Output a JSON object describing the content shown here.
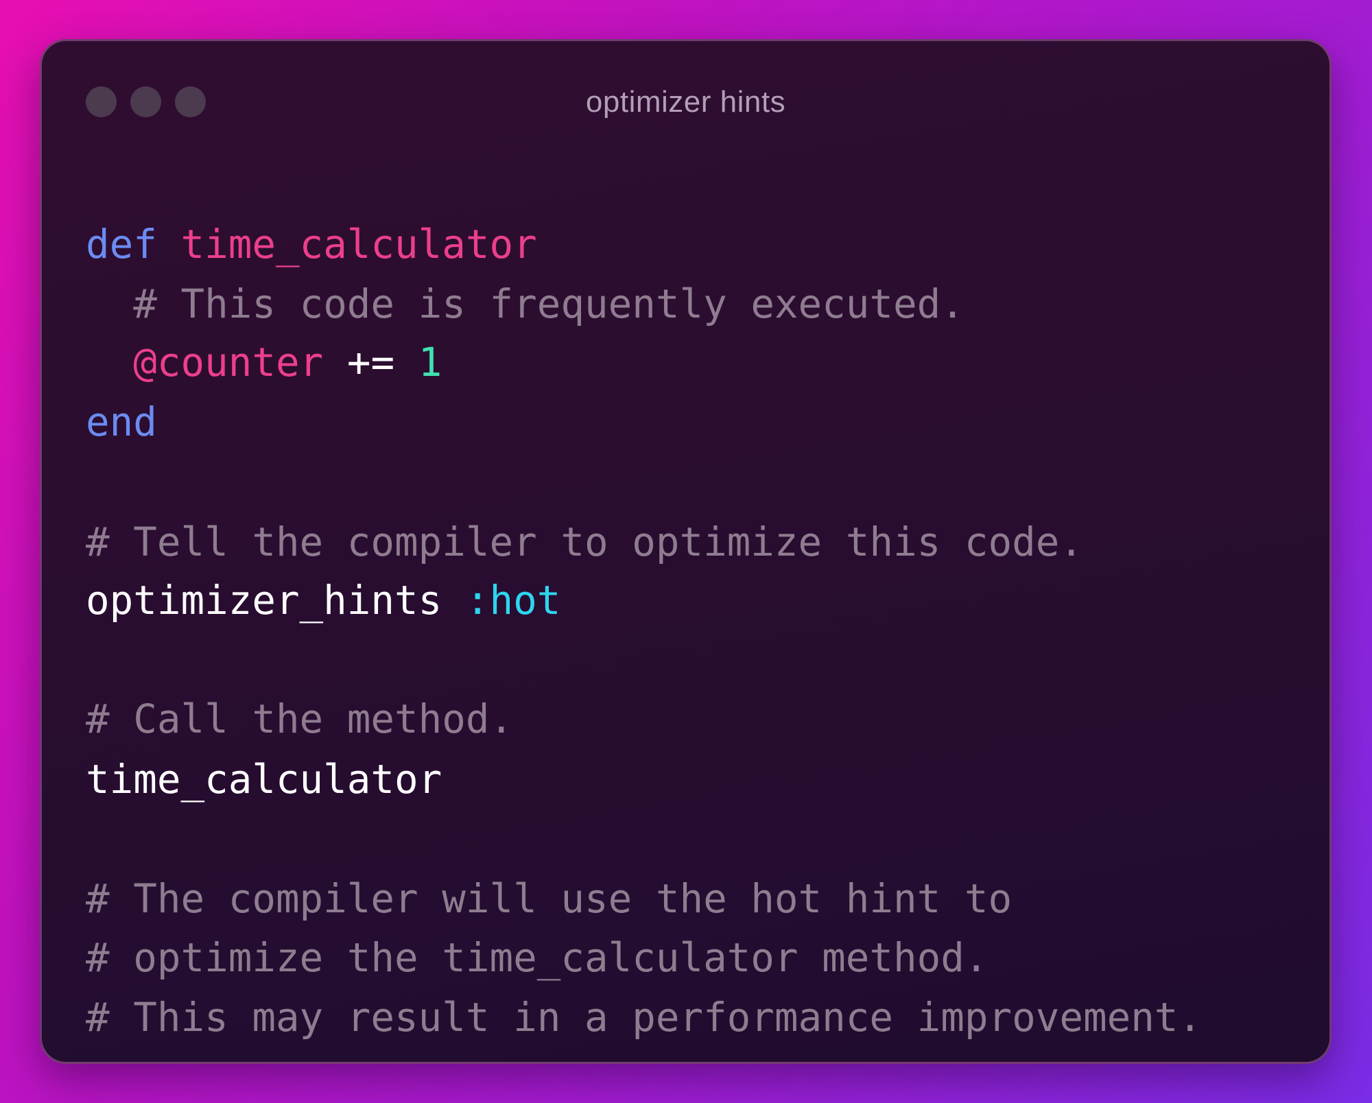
{
  "window": {
    "title": "optimizer hints"
  },
  "code": {
    "line1": {
      "keyword": "def",
      "space": " ",
      "function_name": "time_calculator"
    },
    "line2": {
      "indent": "  ",
      "comment": "# This code is frequently executed."
    },
    "line3": {
      "indent": "  ",
      "ivar": "@counter",
      "operator": " += ",
      "number": "1"
    },
    "line4": {
      "keyword": "end"
    },
    "line6": {
      "comment": "# Tell the compiler to optimize this code."
    },
    "line7": {
      "method": "optimizer_hints ",
      "symbol": ":hot"
    },
    "line9": {
      "comment": "# Call the method."
    },
    "line10": {
      "call": "time_calculator"
    },
    "line12": {
      "comment": "# The compiler will use the hot hint to"
    },
    "line13": {
      "comment": "# optimize the time_calculator method."
    },
    "line14": {
      "comment": "# This may result in a performance improvement."
    }
  },
  "colors": {
    "keyword": "#6b8cf2",
    "function_name": "#ec3f8c",
    "number": "#3fe1b0",
    "symbol": "#2fd5ee",
    "comment": "#8f7c90",
    "plain": "#ffffff"
  }
}
